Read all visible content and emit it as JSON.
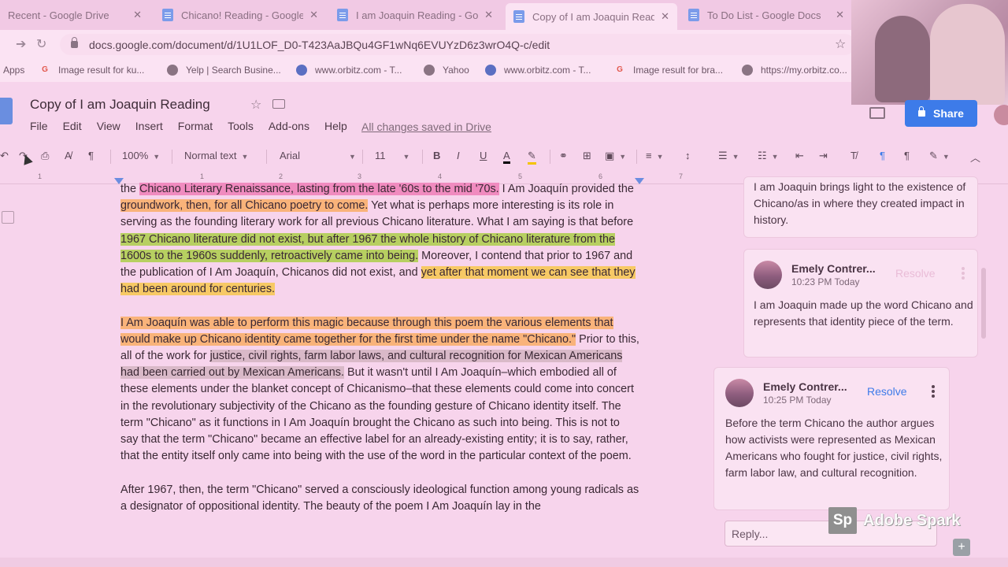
{
  "tabs": [
    {
      "label": "Recent - Google Drive",
      "icon": "google-drive-icon"
    },
    {
      "label": "Chicano! Reading - Google",
      "icon": "docs-icon"
    },
    {
      "label": "I am Joaquin Reading - Go",
      "icon": "docs-icon"
    },
    {
      "label": "Copy of I am Joaquin Read",
      "icon": "docs-icon",
      "active": true
    },
    {
      "label": "To Do List - Google Docs",
      "icon": "docs-icon"
    }
  ],
  "address": {
    "url": "docs.google.com/document/d/1U1LOF_D0-T423AaJBQu4GF1wNq6EVUYzD6z3wrO4Q-c/edit"
  },
  "bookmarks": [
    {
      "label": "Apps"
    },
    {
      "label": "Image result for ku..."
    },
    {
      "label": "Yelp | Search Busine..."
    },
    {
      "label": "www.orbitz.com - T..."
    },
    {
      "label": "Yahoo"
    },
    {
      "label": "www.orbitz.com - T..."
    },
    {
      "label": "Image result for bra..."
    },
    {
      "label": "https://my.orbitz.co..."
    }
  ],
  "doc": {
    "title": "Copy of I am Joaquin Reading",
    "menu": [
      "File",
      "Edit",
      "View",
      "Insert",
      "Format",
      "Tools",
      "Add-ons",
      "Help"
    ],
    "saved_status": "All changes saved in Drive",
    "share_label": "Share"
  },
  "toolbar": {
    "zoom": "100%",
    "style": "Normal text",
    "font": "Arial",
    "size": "11"
  },
  "ruler_numbers": [
    "1",
    "1",
    "2",
    "3",
    "4",
    "5",
    "6",
    "7"
  ],
  "body": {
    "p1": {
      "s1": "Chicano Literary Renaissance, lasting from the late '60s to the mid '70s.",
      "s2": " I Am Joaquín provided the ",
      "s3": "groundwork, then, for all Chicano poetry to come.",
      "s4": " Yet what is perhaps more interesting is its role in serving as the founding literary work for all previous Chicano literature. What I am saying is that before ",
      "s5": "1967 Chicano literature did not exist, but after 1967 the whole history of Chicano literature from the 1600s to the 1960s suddenly, retroactively came into being.",
      "s6": " Moreover, I contend that prior to 1967 and the publication of I Am Joaquín, Chicanos did not exist, and ",
      "s7": "yet after that moment we can see that they had been around for centuries."
    },
    "p2": {
      "s1": "I Am Joaquín was able to perform this magic because through this poem the various elements that would make up Chicano identity came together for the first time under the name \"Chicano.\"",
      "s2": " Prior to this, all of the work for ",
      "s3": "justice, civil rights, farm labor laws, and cultural recognition for Mexican Americans had been carried out by Mexican Americans.",
      "s4": " But it wasn't until I Am Joaquín–which embodied all of these elements under the blanket concept of Chicanismo–that these elements could come into concert in the revolutionary subjectivity of the Chicano as the founding gesture of Chicano identity itself. The term \"Chicano\" as it functions in I Am Joaquín brought the Chicano as such into being. This is not to say that the term \"Chicano\" became an effective label for an already-existing entity; it is to say, rather, that the entity itself only came into being with the use of the word in the particular context of the poem."
    },
    "p3": "After 1967, then, the term \"Chicano\" served a consciously ideological function among young radicals as a designator of oppositional identity. The beauty of the poem I Am Joaquín lay in the"
  },
  "comments": [
    {
      "text": "I am Joaquin brings light to the existence of Chicano/as in where they created impact in history."
    },
    {
      "author": "Emely Contrer...",
      "time": "10:23 PM Today",
      "resolve": "Resolve",
      "text": "I am Joaquin made up the word Chicano and represents that identity piece of the term."
    },
    {
      "author": "Emely Contrer...",
      "time": "10:25 PM Today",
      "resolve": "Resolve",
      "text": "Before the term Chicano the author argues how activists were represented as Mexican Americans who fought for justice, civil rights, farm labor law, and cultural recognition."
    }
  ],
  "reply_placeholder": "Reply...",
  "watermark": "Adobe Spark",
  "colors": {
    "accent": "#3d7be9",
    "highlight_pink": "#f08bbf",
    "highlight_orange": "#f9b37a",
    "highlight_green": "#b7cf61",
    "highlight_yellow": "#f7c965"
  }
}
